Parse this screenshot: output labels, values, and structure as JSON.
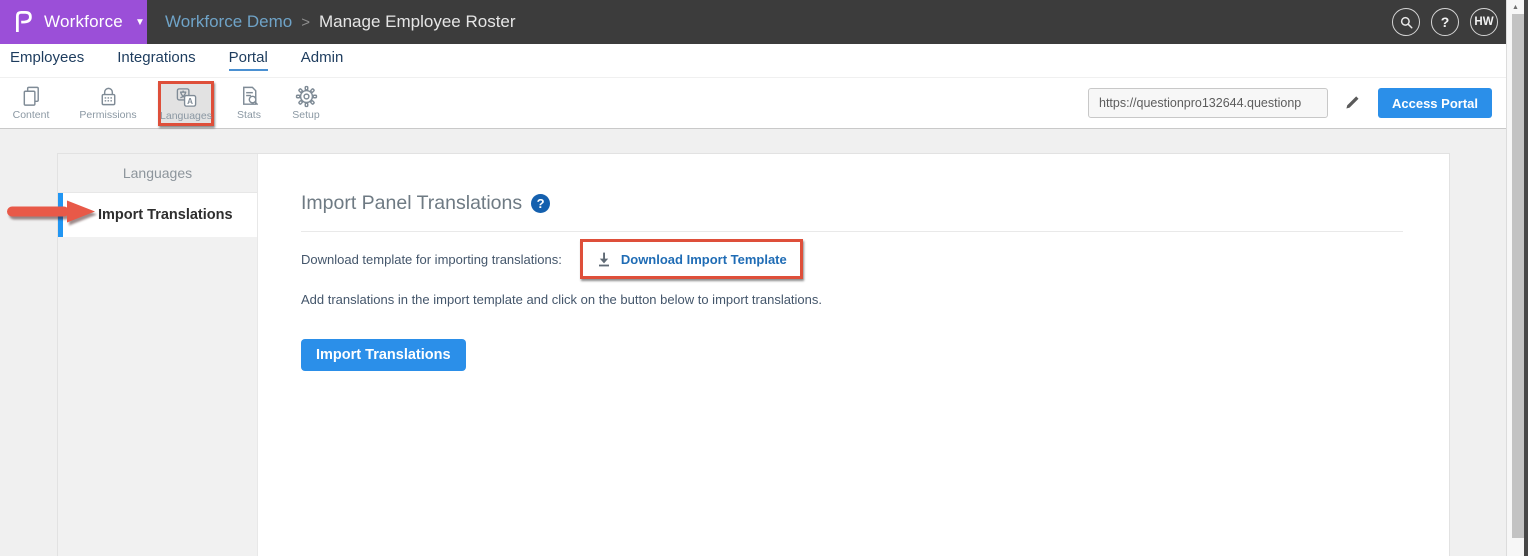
{
  "topbar": {
    "brand_label": "Workforce",
    "brand_caret": "▼",
    "breadcrumb": {
      "parent": "Workforce Demo",
      "separator": ">",
      "current": "Manage Employee Roster"
    },
    "help_glyph": "?",
    "avatar_initials": "HW",
    "icons": [
      "search-icon",
      "help-icon",
      "avatar"
    ]
  },
  "nav": {
    "items": [
      {
        "label": "Employees",
        "active": false
      },
      {
        "label": "Integrations",
        "active": false
      },
      {
        "label": "Portal",
        "active": true
      },
      {
        "label": "Admin",
        "active": false
      }
    ]
  },
  "toolbar": {
    "items": [
      {
        "label": "Content",
        "icon": "pages-icon",
        "selected": false
      },
      {
        "label": "Permissions",
        "icon": "lock-icon",
        "selected": false
      },
      {
        "label": "Languages",
        "icon": "translate-icon",
        "selected": true,
        "annotated": true
      },
      {
        "label": "Stats",
        "icon": "doc-search-icon",
        "selected": false
      },
      {
        "label": "Setup",
        "icon": "gear-icon",
        "selected": false
      }
    ],
    "portal_url": {
      "value": "https://questionpro132644.questionp"
    },
    "edit_icon": "pencil-icon",
    "access_portal_label": "Access Portal"
  },
  "sidebar": {
    "header": "Languages",
    "items": [
      {
        "label": "Import Translations",
        "active": true,
        "annotated_arrow": true
      }
    ]
  },
  "content": {
    "title": "Import Panel Translations",
    "help_glyph": "?",
    "download_label": "Download template for importing translations:",
    "download_link_label": "Download Import Template",
    "download_icon": "download-icon",
    "instruction": "Add translations in the import template and click on the button below to import translations.",
    "import_button_label": "Import Translations"
  },
  "colors": {
    "brand_purple": "#9b4fd8",
    "topbar_bg": "#3c3c3c",
    "breadcrumb_parent": "#6fa3c7",
    "primary_blue": "#2b8fe9",
    "link_blue": "#1f6cb5",
    "help_badge_blue": "#1460ae",
    "nav_text": "#1d3c5e",
    "annotation_red": "#de4f3a",
    "active_item_bar": "#2196f3",
    "portal_underline": "#4a90d2"
  }
}
